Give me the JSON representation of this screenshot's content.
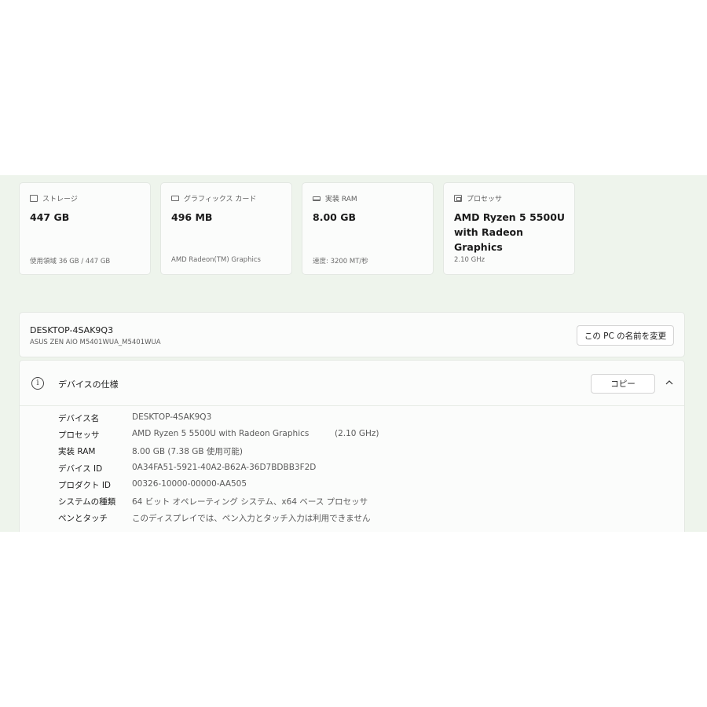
{
  "cards": [
    {
      "icon": "storage-icon",
      "label": "ストレージ",
      "value": "447 GB",
      "sub": "使用領域 36 GB / 447 GB"
    },
    {
      "icon": "graphics-card-icon",
      "label": "グラフィックス カード",
      "value": "496 MB",
      "sub": "AMD Radeon(TM) Graphics"
    },
    {
      "icon": "ram-icon",
      "label": "実装 RAM",
      "value": "8.00 GB",
      "sub": "速度: 3200 MT/秒"
    },
    {
      "icon": "processor-icon",
      "label": "プロセッサ",
      "value": "AMD Ryzen 5 5500U with Radeon Graphics",
      "sub": "2.10 GHz"
    }
  ],
  "pc": {
    "name": "DESKTOP-4SAK9Q3",
    "model": "ASUS ZEN AIO M5401WUA_M5401WUA",
    "rename_label": "この PC の名前を変更"
  },
  "spec": {
    "title": "デバイスの仕様",
    "copy_label": "コピー",
    "rows": [
      {
        "key": "デバイス名",
        "value": "DESKTOP-4SAK9Q3",
        "extra": ""
      },
      {
        "key": "プロセッサ",
        "value": "AMD Ryzen 5 5500U with Radeon Graphics",
        "extra": "(2.10 GHz)"
      },
      {
        "key": "実装 RAM",
        "value": "8.00 GB (7.38 GB 使用可能)",
        "extra": ""
      },
      {
        "key": "デバイス ID",
        "value": "0A34FA51-5921-40A2-B62A-36D7BDBB3F2D",
        "extra": ""
      },
      {
        "key": "プロダクト ID",
        "value": "00326-10000-00000-AA505",
        "extra": ""
      },
      {
        "key": "システムの種類",
        "value": "64 ビット オペレーティング システム、x64 ベース プロセッサ",
        "extra": ""
      },
      {
        "key": "ペンとタッチ",
        "value": "このディスプレイでは、ペン入力とタッチ入力は利用できません",
        "extra": ""
      }
    ]
  },
  "colors": {
    "panel_bg": "#eef4ec",
    "card_bg": "#fbfcfb",
    "border": "#e3e8e2"
  }
}
